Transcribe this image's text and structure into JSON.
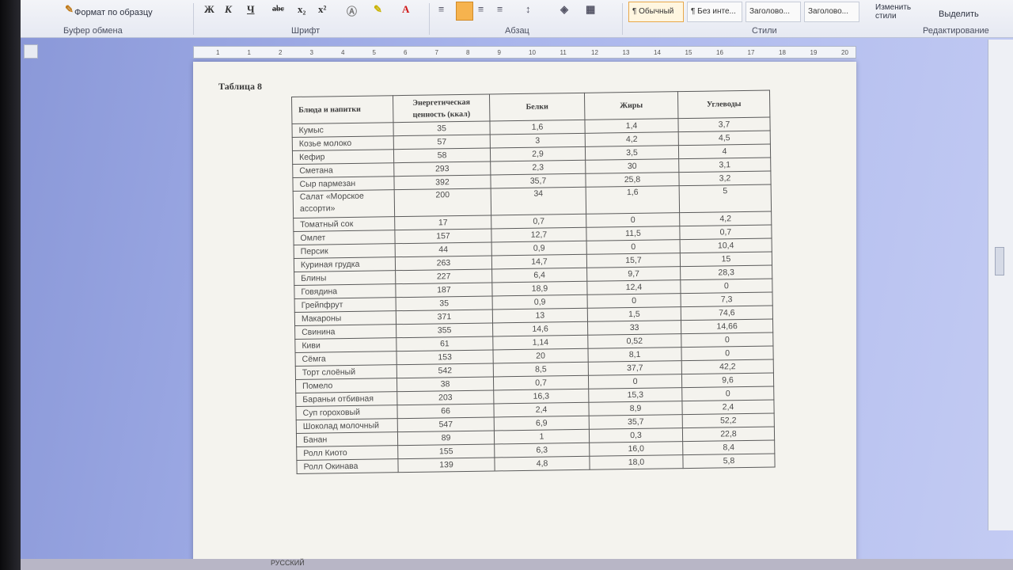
{
  "ribbon": {
    "format_painter_label": "Формат по образцу",
    "clipboard_group": "Буфер обмена",
    "font_group": "Шрифт",
    "paragraph_group": "Абзац",
    "styles_group": "Стили",
    "editing_group": "Редактирование",
    "change_styles_label": "Изменить стили",
    "select_label": "Выделить",
    "styles": [
      "¶ Обычный",
      "¶ Без инте...",
      "Заголово...",
      "Заголово..."
    ],
    "font_buttons": [
      "Ж",
      "К",
      "Ч",
      "abc",
      "x₂",
      "x²"
    ]
  },
  "ruler": {
    "ticks": [
      "1",
      "1",
      "2",
      "3",
      "4",
      "5",
      "6",
      "7",
      "8",
      "9",
      "10",
      "11",
      "12",
      "13",
      "14",
      "15",
      "16",
      "17",
      "18",
      "19",
      "20"
    ]
  },
  "document": {
    "caption": "Таблица 8",
    "table": {
      "headers": [
        "Блюда и напитки",
        "Энергетическая ценность (ккал)",
        "Белки",
        "Жиры",
        "Углеводы"
      ],
      "rows": [
        [
          "Кумыс",
          "35",
          "1,6",
          "1,4",
          "3,7"
        ],
        [
          "Козье молоко",
          "57",
          "3",
          "4,2",
          "4,5"
        ],
        [
          "Кефир",
          "58",
          "2,9",
          "3,5",
          "4"
        ],
        [
          "Сметана",
          "293",
          "2,3",
          "30",
          "3,1"
        ],
        [
          "Сыр пармезан",
          "392",
          "35,7",
          "25,8",
          "3,2"
        ],
        [
          "Салат «Морское ассорти»",
          "200",
          "34",
          "1,6",
          "5"
        ],
        [
          "Томатный сок",
          "17",
          "0,7",
          "0",
          "4,2"
        ],
        [
          "Омлет",
          "157",
          "12,7",
          "11,5",
          "0,7"
        ],
        [
          "Персик",
          "44",
          "0,9",
          "0",
          "10,4"
        ],
        [
          "Куриная грудка",
          "263",
          "14,7",
          "15,7",
          "15"
        ],
        [
          "Блины",
          "227",
          "6,4",
          "9,7",
          "28,3"
        ],
        [
          "Говядина",
          "187",
          "18,9",
          "12,4",
          "0"
        ],
        [
          "Грейпфрут",
          "35",
          "0,9",
          "0",
          "7,3"
        ],
        [
          "Макароны",
          "371",
          "13",
          "1,5",
          "74,6"
        ],
        [
          "Свинина",
          "355",
          "14,6",
          "33",
          "14,66"
        ],
        [
          "Киви",
          "61",
          "1,14",
          "0,52",
          "0"
        ],
        [
          "Сёмга",
          "153",
          "20",
          "8,1",
          "0"
        ],
        [
          "Торт слоёный",
          "542",
          "8,5",
          "37,7",
          "42,2"
        ],
        [
          "Помело",
          "38",
          "0,7",
          "0",
          "9,6"
        ],
        [
          "Бараньи отбивная",
          "203",
          "16,3",
          "15,3",
          "0"
        ],
        [
          "Суп гороховый",
          "66",
          "2,4",
          "8,9",
          "2,4"
        ],
        [
          "Шоколад молочный",
          "547",
          "6,9",
          "35,7",
          "52,2"
        ],
        [
          "Банан",
          "89",
          "1",
          "0,3",
          "22,8"
        ],
        [
          "Ролл Киото",
          "155",
          "6,3",
          "16,0",
          "8,4"
        ],
        [
          "Ролл Окинава",
          "139",
          "4,8",
          "18,0",
          "5,8"
        ]
      ]
    }
  },
  "taskbar": {
    "language": "РУССКИЙ"
  },
  "colors": {
    "workspace": "#a9b5ec",
    "page": "#f4f3ee",
    "ribbon": "#e9ecf3",
    "highlight_button": "#f6b34e"
  }
}
